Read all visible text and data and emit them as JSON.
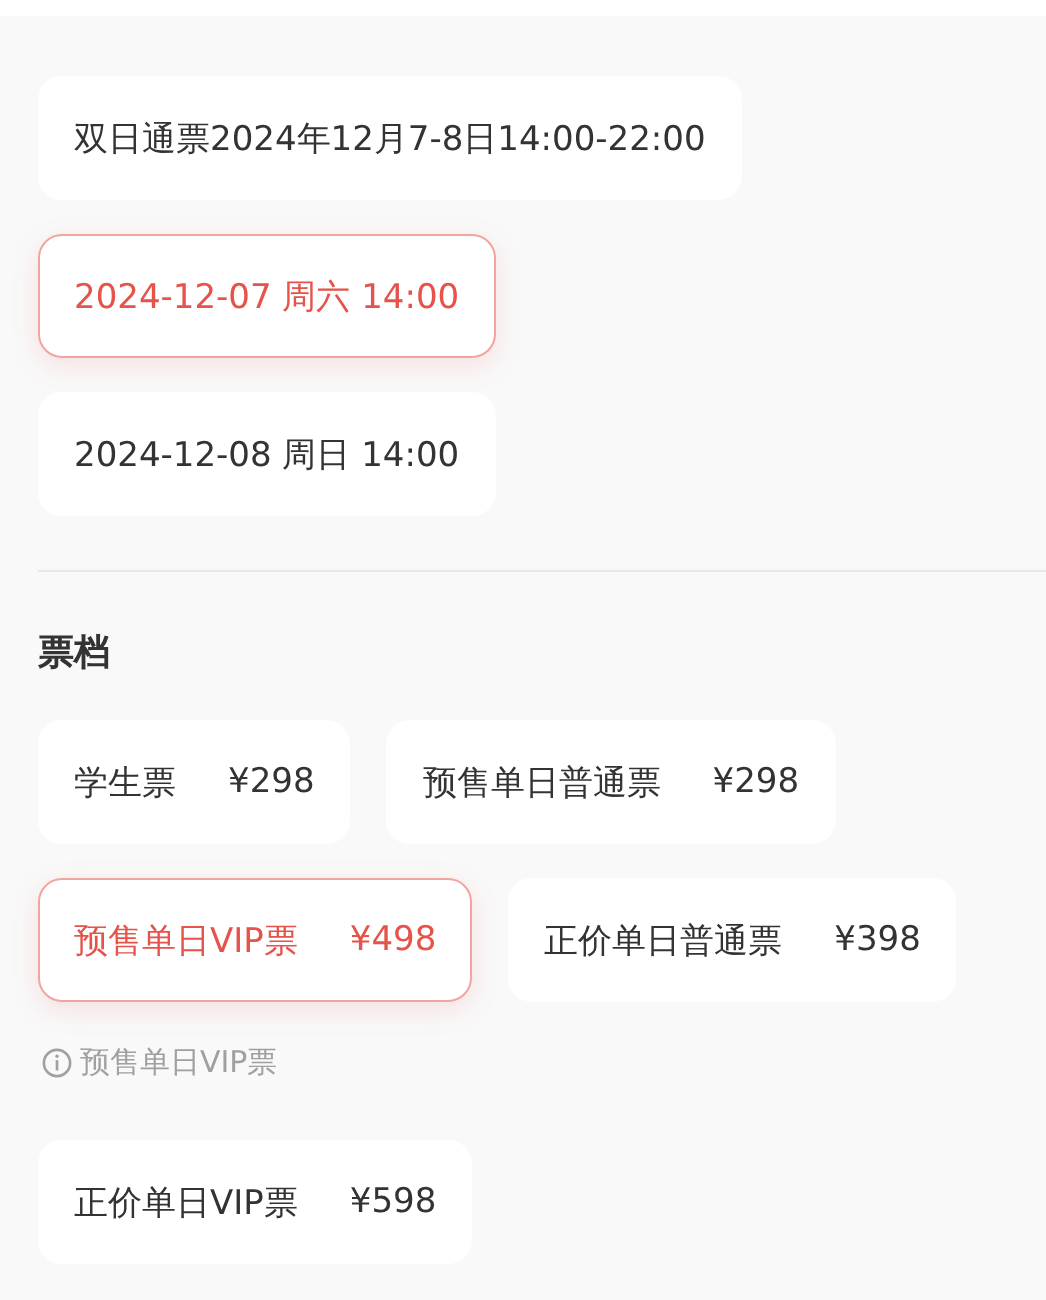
{
  "sessions": [
    {
      "label": "双日通票2024年12月7-8日14:00-22:00",
      "selected": false
    },
    {
      "label": "2024-12-07 周六 14:00",
      "selected": true
    },
    {
      "label": "2024-12-08 周日 14:00",
      "selected": false
    }
  ],
  "tiers_title": "票档",
  "ticket_tiers": [
    {
      "kind": "tier",
      "name": "学生票",
      "price": "¥298",
      "selected": false
    },
    {
      "kind": "tier",
      "name": "预售单日普通票",
      "price": "¥298",
      "selected": false
    },
    {
      "kind": "tier",
      "name": "预售单日VIP票",
      "price": "¥498",
      "selected": true
    },
    {
      "kind": "tier",
      "name": "正价单日普通票",
      "price": "¥398",
      "selected": false
    },
    {
      "kind": "note",
      "name": "预售单日VIP票"
    },
    {
      "kind": "tier",
      "name": "正价单日VIP票",
      "price": "¥598",
      "selected": false
    }
  ]
}
